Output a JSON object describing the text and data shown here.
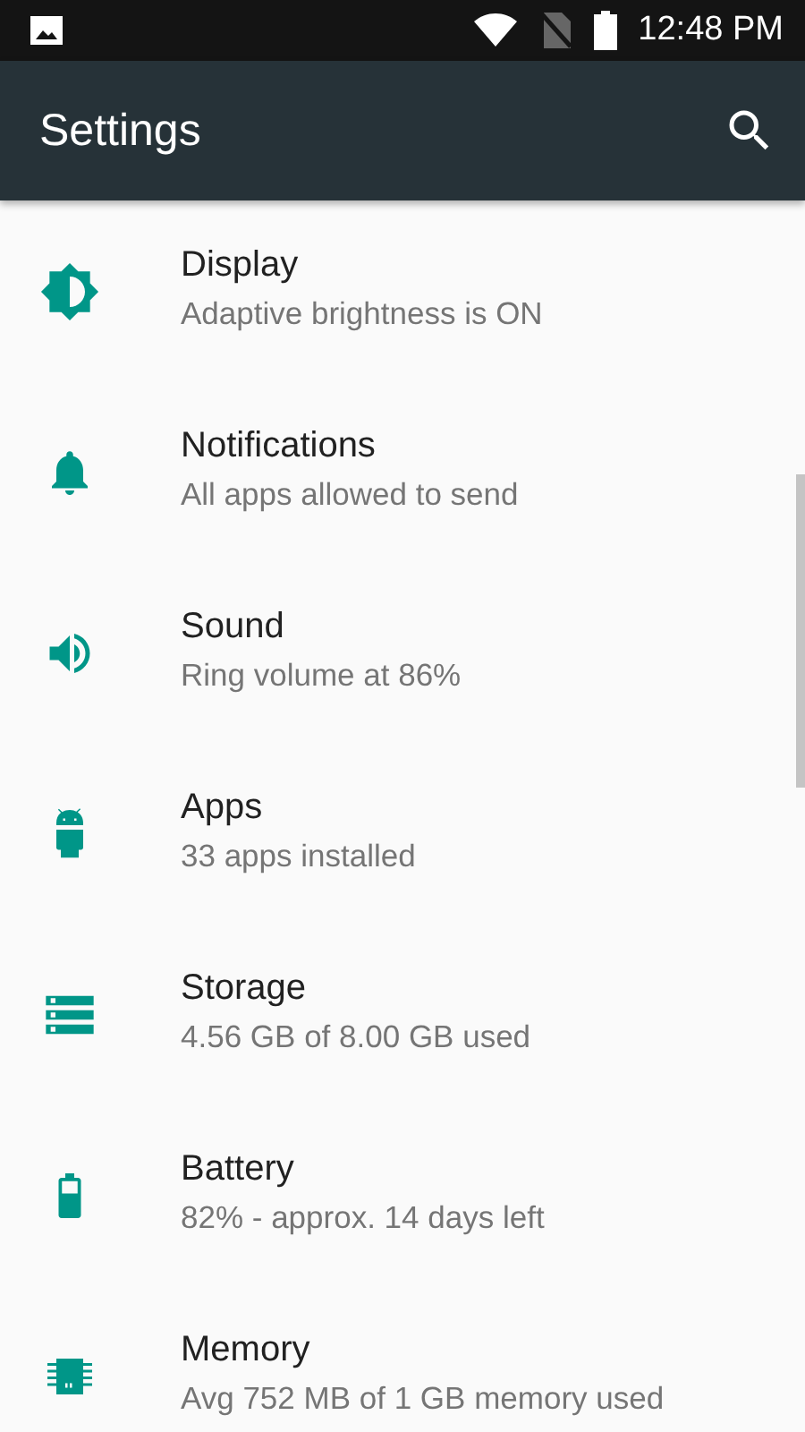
{
  "status_bar": {
    "time": "12:48 PM"
  },
  "toolbar": {
    "title": "Settings"
  },
  "items": [
    {
      "title": "Display",
      "summary": "Adaptive brightness is ON"
    },
    {
      "title": "Notifications",
      "summary": "All apps allowed to send"
    },
    {
      "title": "Sound",
      "summary": "Ring volume at 86%"
    },
    {
      "title": "Apps",
      "summary": "33 apps installed"
    },
    {
      "title": "Storage",
      "summary": "4.56 GB of 8.00 GB used"
    },
    {
      "title": "Battery",
      "summary": "82% - approx. 14 days left"
    },
    {
      "title": "Memory",
      "summary": "Avg 752 MB of 1 GB memory used"
    }
  ]
}
